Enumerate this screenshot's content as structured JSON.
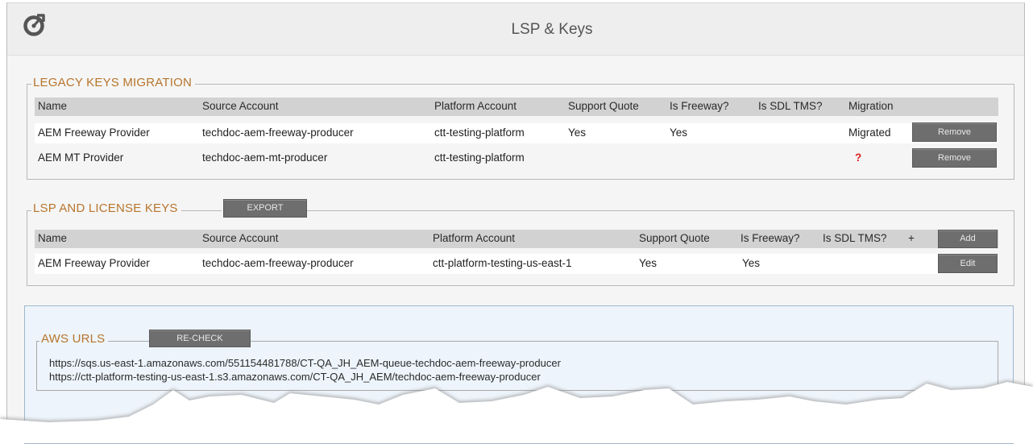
{
  "header": {
    "title": "LSP & Keys",
    "logo_icon": "refresh-target-icon"
  },
  "legacy": {
    "legend": "LEGACY KEYS MIGRATION",
    "columns": [
      "Name",
      "Source Account",
      "Platform Account",
      "Support Quote",
      "Is Freeway?",
      "Is SDL TMS?",
      "Migration"
    ],
    "rows": [
      {
        "name": "AEM Freeway Provider",
        "source": "techdoc-aem-freeway-producer",
        "platform": "ctt-testing-platform",
        "support": "Yes",
        "freeway": "Yes",
        "sdl": "",
        "migration": "Migrated",
        "button": "Remove"
      },
      {
        "name": "AEM MT Provider",
        "source": "techdoc-aem-mt-producer",
        "platform": "ctt-testing-platform",
        "support": "",
        "freeway": "",
        "sdl": "",
        "migration": "?",
        "button": "Remove"
      }
    ]
  },
  "lsp": {
    "legend": "LSP AND LICENSE KEYS",
    "export_label": "EXPORT",
    "columns": [
      "Name",
      "Source Account",
      "Platform Account",
      "Support Quote",
      "Is Freeway?",
      "Is SDL TMS?"
    ],
    "plus": "+",
    "add_label": "Add",
    "rows": [
      {
        "name": "AEM Freeway Provider",
        "source": "techdoc-aem-freeway-producer",
        "platform": "ctt-platform-testing-us-east-1",
        "support": "Yes",
        "freeway": "Yes",
        "sdl": "",
        "button": "Edit"
      }
    ]
  },
  "aws": {
    "legend": "AWS URLS",
    "recheck_label": "RE-CHECK",
    "urls": [
      "https://sqs.us-east-1.amazonaws.com/551154481788/CT-QA_JH_AEM-queue-techdoc-aem-freeway-producer",
      "https://ctt-platform-testing-us-east-1.s3.amazonaws.com/CT-QA_JH_AEM/techdoc-aem-freeway-producer"
    ]
  },
  "colors": {
    "legend": "#b7752c",
    "button": "#6e6e6e",
    "table_header": "#d2d2d2",
    "aws_panel": "#edf4fb",
    "question": "#e02020"
  }
}
